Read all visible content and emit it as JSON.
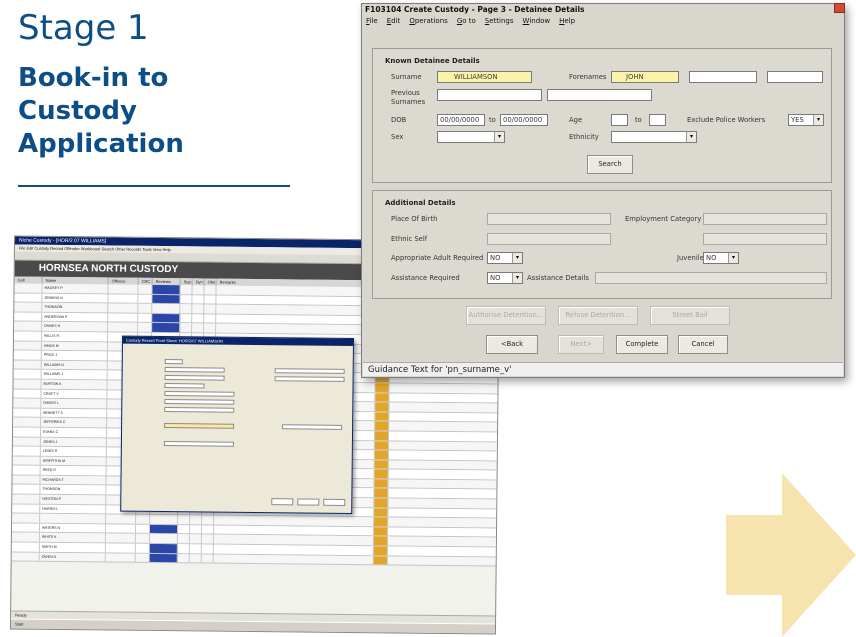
{
  "slide": {
    "stage": "Stage 1",
    "subtitle": "Book-in to Custody Application",
    "accent_color": "#0d4e86",
    "arrow_color": "#f6e3ad"
  },
  "window": {
    "title": "F103104 Create Custody - Page 3 - Detainee Details",
    "menu": [
      "File",
      "Edit",
      "Operations",
      "Go to",
      "Settings",
      "Window",
      "Help"
    ],
    "known": {
      "heading": "Known Detainee Details",
      "surname_label": "Surname",
      "surname_value": "WILLIAMSON",
      "forenames_label": "Forenames",
      "forename_value": "JOHN",
      "previous_label_1": "Previous",
      "previous_label_2": "Surnames",
      "dob_label": "DOB",
      "dob_from": "00/00/0000",
      "dob_to_label": "to",
      "dob_to": "00/00/0000",
      "age_label": "Age",
      "age_to_label": "to",
      "exclude_label": "Exclude Police Workers",
      "exclude_value": "YES",
      "sex_label": "Sex",
      "ethnicity_label": "Ethnicity",
      "search_button": "Search"
    },
    "additional": {
      "heading": "Additional Details",
      "place_of_birth_label": "Place Of Birth",
      "employment_label": "Employment Category",
      "ethnic_self_label": "Ethnic Self",
      "appropriate_adult_label": "Appropriate Adult Required",
      "appropriate_adult_value": "NO",
      "juvenile_label": "Juvenile",
      "juvenile_value": "NO",
      "assistance_label": "Assistance Required",
      "assistance_value": "NO",
      "assistance_details_label": "Assistance Details"
    },
    "buttons": {
      "authorise": "Authorise Detention...",
      "refuse": "Refuse Detention...",
      "street_bail": "Street Bail",
      "back": "<Back",
      "next": "Next>",
      "complete": "Complete",
      "cancel": "Cancel"
    },
    "guidance": "Guidance Text for 'pn_surname_v'"
  },
  "background_app": {
    "title": "Niche Custody - [HOR/2 07 WILLIAMS]",
    "menu": "File  Edit  Custody Record  Offender  Workboard  Search  Other Records  Tools  View  Help",
    "banner": "HORNSEA NORTH CUSTODY",
    "columns": [
      "Cell",
      "Name",
      "Offence",
      "CRC",
      "Reviews",
      "Sup",
      "Dyn",
      "Obs",
      "Remarks"
    ],
    "rows": [
      "MACKEY P",
      "JENKINS N",
      "THOMSON",
      "ANDERSON P",
      "DAVIES H",
      "WILLIS R",
      "HINDS M",
      "PRICE J",
      "WILLIAMS G",
      "WILLIAMS J",
      "BURTON K",
      "CROFT V",
      "DAVIES L",
      "BENNETT S",
      "JEFFERIES C",
      "EVANS C",
      "JONES J",
      "LEWIS R",
      "GRIFFITHS M",
      "REED G",
      "RICHARDS T",
      "THOMSON",
      "WESTON P",
      "HARRIS L",
      "",
      "WATERS N",
      "WHITE K",
      "SMITH M",
      "OWEN G"
    ],
    "dialog_title": "Custody Record Front Sheet: HOR/2/07 WILLIAMSON",
    "status": "Ready",
    "taskbar": "Start"
  }
}
